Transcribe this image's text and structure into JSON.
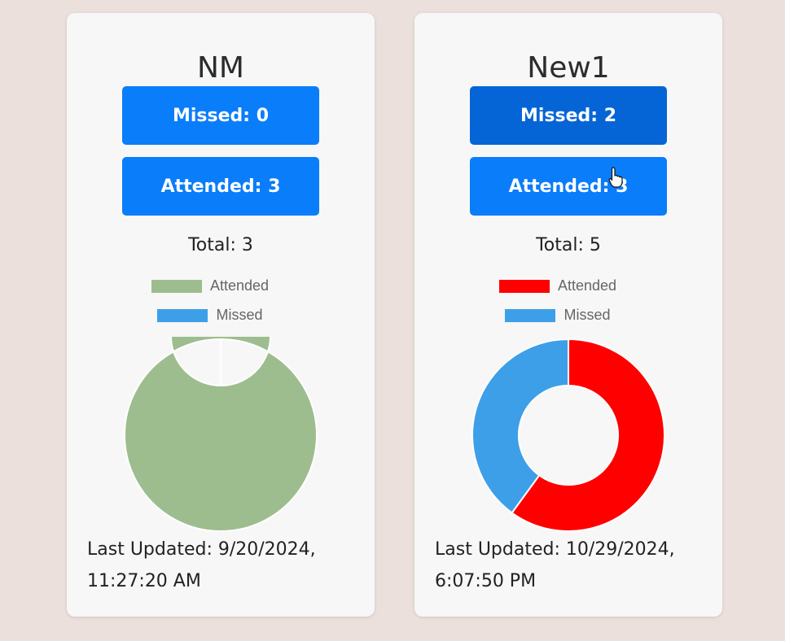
{
  "cards": [
    {
      "title": "NM",
      "missed_label": "Missed: 0",
      "attended_label": "Attended: 3",
      "total_label": "Total: 3",
      "legend": [
        {
          "label": "Attended",
          "color": "#9dbd8f"
        },
        {
          "label": "Missed",
          "color": "#3d9fe8"
        }
      ],
      "last_updated_label": "Last Updated: 9/20/2024,",
      "last_updated_time": "11:27:20 AM"
    },
    {
      "title": "New1",
      "missed_label": "Missed: 2",
      "attended_label": "Attended: 3",
      "total_label": "Total: 5",
      "legend": [
        {
          "label": "Attended",
          "color": "#ff0000"
        },
        {
          "label": "Missed",
          "color": "#3d9fe8"
        }
      ],
      "last_updated_label": "Last Updated: 10/29/2024,",
      "last_updated_time": "6:07:50 PM"
    }
  ],
  "chart_data": [
    {
      "type": "pie",
      "categories": [
        "Attended",
        "Missed"
      ],
      "values": [
        3,
        0
      ],
      "colors": [
        "#9dbd8f",
        "#3d9fe8"
      ],
      "donut": true
    },
    {
      "type": "pie",
      "categories": [
        "Attended",
        "Missed"
      ],
      "values": [
        3,
        2
      ],
      "colors": [
        "#ff0000",
        "#3d9fe8"
      ],
      "donut": true
    }
  ],
  "cursor": {
    "icon": "hand-pointer-icon"
  }
}
